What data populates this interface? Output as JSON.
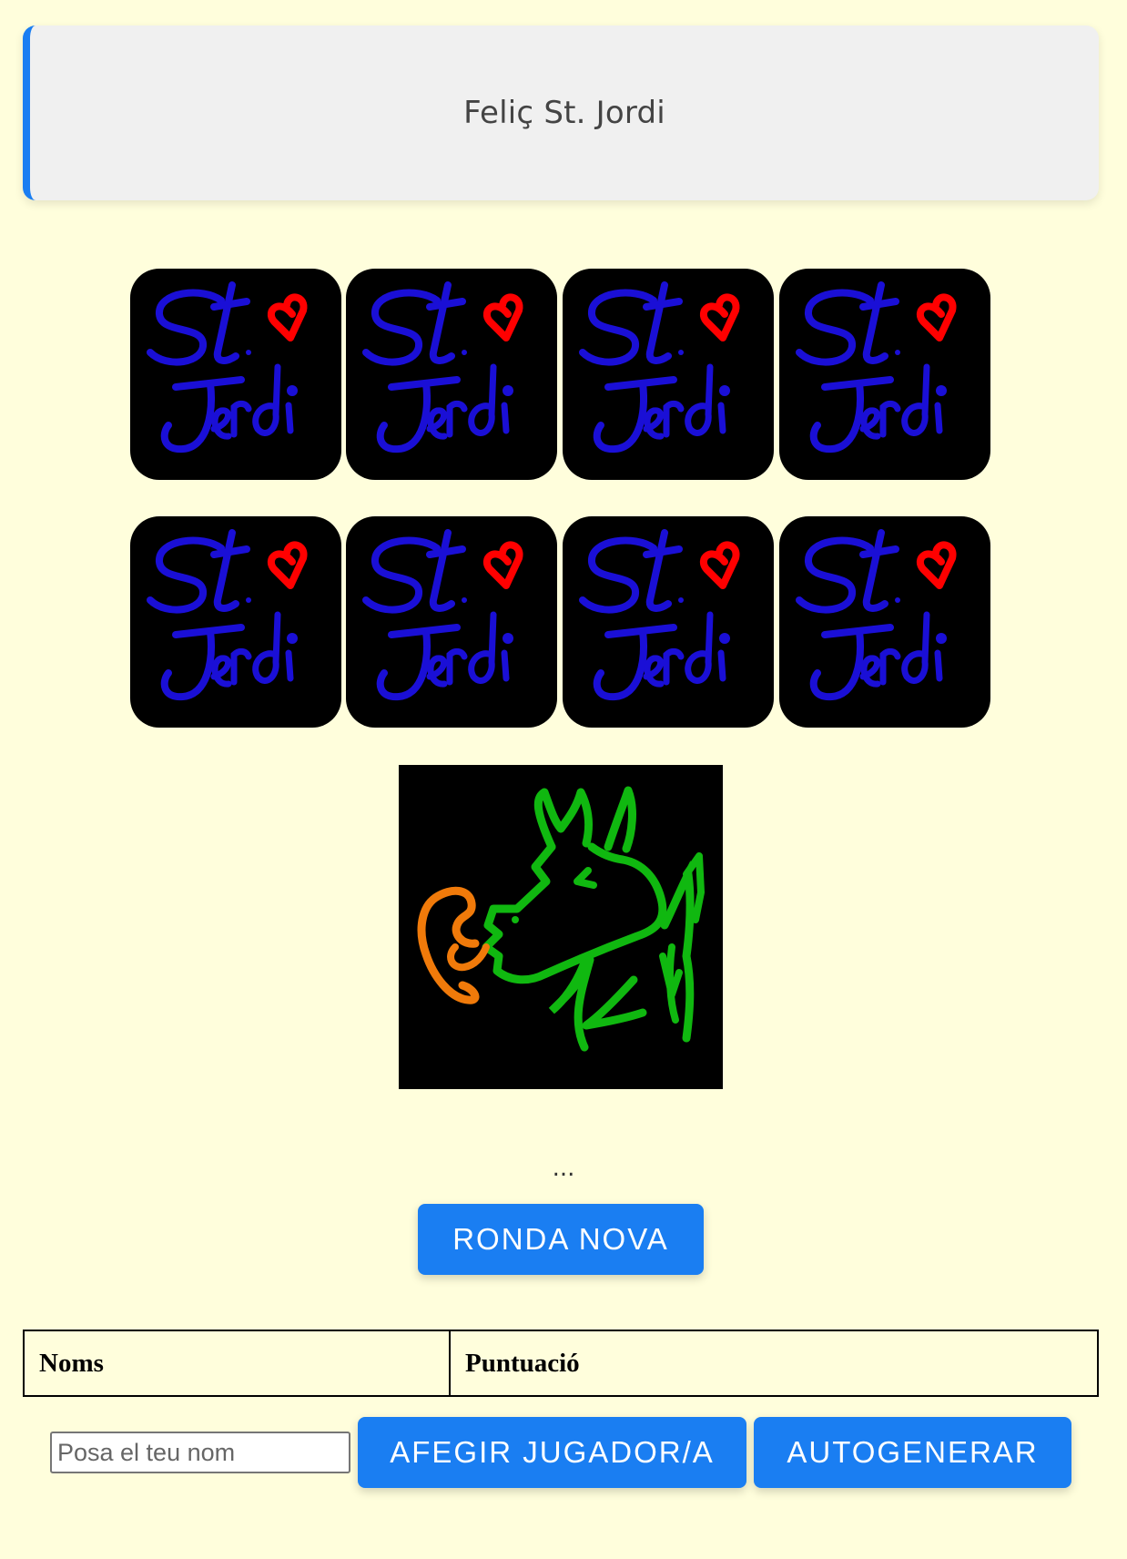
{
  "banner": {
    "title": "Feliç St. Jordi"
  },
  "cards": [
    {
      "face": "card-back",
      "text_top": "St.",
      "text_bottom": "Jordi"
    },
    {
      "face": "card-back",
      "text_top": "St.",
      "text_bottom": "Jordi"
    },
    {
      "face": "card-back",
      "text_top": "St.",
      "text_bottom": "Jordi"
    },
    {
      "face": "card-back",
      "text_top": "St.",
      "text_bottom": "Jordi"
    },
    {
      "face": "card-back",
      "text_top": "St.",
      "text_bottom": "Jordi"
    },
    {
      "face": "card-back",
      "text_top": "St.",
      "text_bottom": "Jordi"
    },
    {
      "face": "card-back",
      "text_top": "St.",
      "text_bottom": "Jordi"
    },
    {
      "face": "card-back",
      "text_top": "St.",
      "text_bottom": "Jordi"
    }
  ],
  "card_colors": {
    "text": "#1a0fd6",
    "heart": "#ff0000",
    "background": "#000000"
  },
  "dragon": {
    "icon": "dragon-with-rose-icon",
    "colors": {
      "body": "#10b810",
      "rose": "#f07a0a",
      "background": "#000000"
    }
  },
  "status": {
    "text": "..."
  },
  "buttons": {
    "new_round": "RONDA NOVA",
    "add_player": "AFEGIR JUGADOR/A",
    "autogenerate": "AUTOGENERAR"
  },
  "scores_table": {
    "headers": [
      "Noms",
      "Puntuació"
    ]
  },
  "player_input": {
    "placeholder": "Posa el teu nom",
    "value": ""
  },
  "colors": {
    "accent": "#1a7ef2",
    "page_background": "#fffedc",
    "banner_background": "#f0f0f0"
  }
}
